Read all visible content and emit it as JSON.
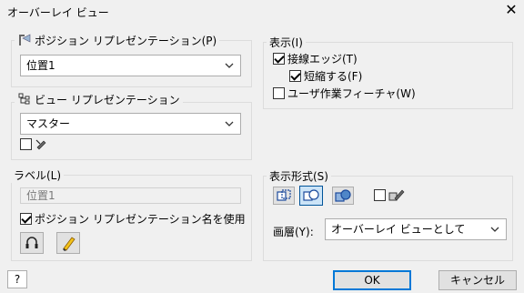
{
  "window": {
    "title": "オーバーレイ ビュー"
  },
  "position_rep": {
    "label": "ポジション リプレゼンテーション(P)",
    "value": "位置1"
  },
  "view_rep": {
    "label": "ビュー リプレゼンテーション",
    "value": "マスター"
  },
  "label_group": {
    "label": "ラベル(L)",
    "field_value": "位置1",
    "use_name_label": "ポジション リプレゼンテーション名を使用"
  },
  "display": {
    "label": "表示(I)",
    "tangent_edges": "接線エッジ(T)",
    "shorten": "短縮する(F)",
    "user_work_features": "ユーザ作業フィーチャ(W)"
  },
  "display_style": {
    "label": "表示形式(S)",
    "layer_label": "画層(Y):",
    "layer_value": "オーバーレイ ビューとして"
  },
  "buttons": {
    "ok": "OK",
    "cancel": "キャンセル",
    "help": "?"
  }
}
